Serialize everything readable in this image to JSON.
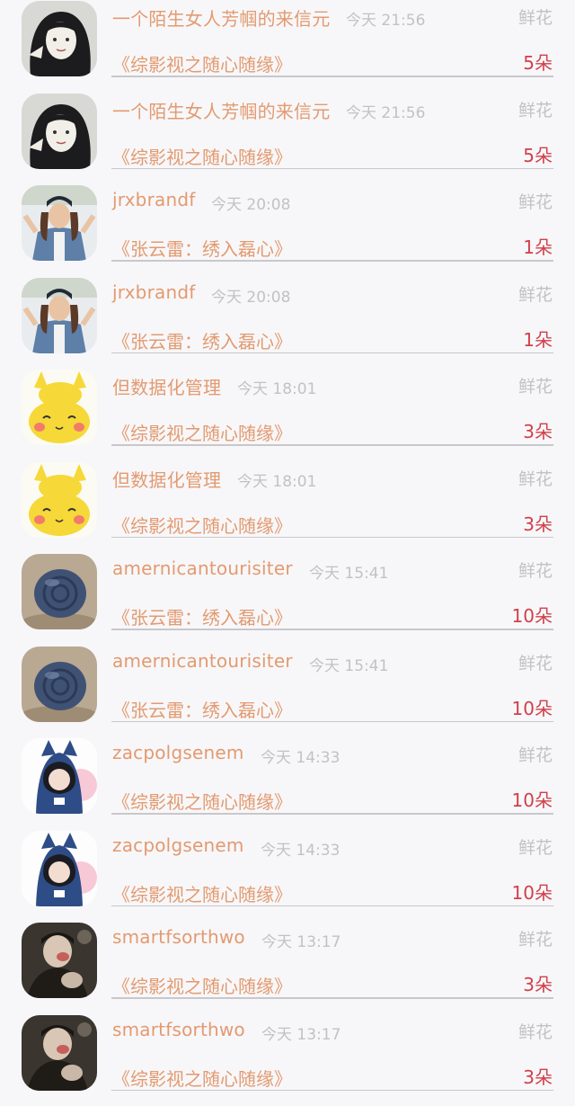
{
  "items": [
    {
      "name": "一个陌生女人芳帼的来信元",
      "time": "今天 21:56",
      "gift_type": "鲜花",
      "book": "《综影视之随心随缘》",
      "count": "5朵",
      "avatar": "girl-bw"
    },
    {
      "name": "一个陌生女人芳帼的来信元",
      "time": "今天 21:56",
      "gift_type": "鲜花",
      "book": "《综影视之随心随缘》",
      "count": "5朵",
      "avatar": "girl-bw"
    },
    {
      "name": "jrxbrandf",
      "time": "今天 20:08",
      "gift_type": "鲜花",
      "book": "《张云雷：绣入磊心》",
      "count": "1朵",
      "avatar": "girl-denim"
    },
    {
      "name": "jrxbrandf",
      "time": "今天 20:08",
      "gift_type": "鲜花",
      "book": "《张云雷：绣入磊心》",
      "count": "1朵",
      "avatar": "girl-denim"
    },
    {
      "name": "但数据化管理",
      "time": "今天 18:01",
      "gift_type": "鲜花",
      "book": "《综影视之随心随缘》",
      "count": "3朵",
      "avatar": "pikachu"
    },
    {
      "name": "但数据化管理",
      "time": "今天 18:01",
      "gift_type": "鲜花",
      "book": "《综影视之随心随缘》",
      "count": "3朵",
      "avatar": "pikachu"
    },
    {
      "name": "amernicantourisiter",
      "time": "今天 15:41",
      "gift_type": "鲜花",
      "book": "《张云雷：绣入磊心》",
      "count": "10朵",
      "avatar": "snail-shell"
    },
    {
      "name": "amernicantourisiter",
      "time": "今天 15:41",
      "gift_type": "鲜花",
      "book": "《张云雷：绣入磊心》",
      "count": "10朵",
      "avatar": "snail-shell"
    },
    {
      "name": "zacpolgsenem",
      "time": "今天 14:33",
      "gift_type": "鲜花",
      "book": "《综影视之随心随缘》",
      "count": "10朵",
      "avatar": "anime-girl"
    },
    {
      "name": "zacpolgsenem",
      "time": "今天 14:33",
      "gift_type": "鲜花",
      "book": "《综影视之随心随缘》",
      "count": "10朵",
      "avatar": "anime-girl"
    },
    {
      "name": "smartfsorthwo",
      "time": "今天 13:17",
      "gift_type": "鲜花",
      "book": "《综影视之随心随缘》",
      "count": "3朵",
      "avatar": "dark-photo"
    },
    {
      "name": "smartfsorthwo",
      "time": "今天 13:17",
      "gift_type": "鲜花",
      "book": "《综影视之随心随缘》",
      "count": "3朵",
      "avatar": "dark-photo"
    }
  ],
  "colors": {
    "background": "#f7f7f9",
    "name_text": "#e39a70",
    "meta_text": "#c2c2c2",
    "count_text": "#d0404a",
    "divider": "#c8c8cc"
  }
}
